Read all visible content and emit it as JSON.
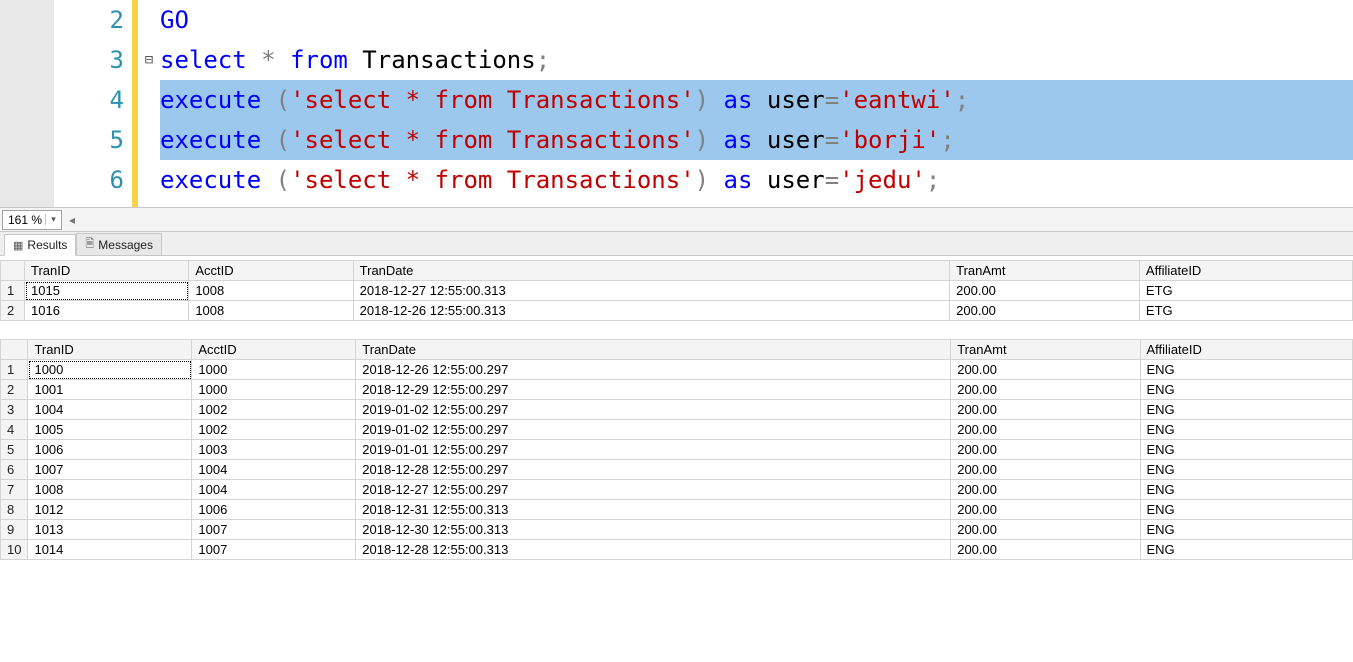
{
  "zoom": {
    "value": "161 %"
  },
  "tabs": {
    "results": "Results",
    "messages": "Messages"
  },
  "code": {
    "lines": [
      {
        "n": 2,
        "fold": "",
        "sel": false,
        "tokens": [
          [
            "kw",
            "GO"
          ]
        ]
      },
      {
        "n": 3,
        "fold": "⊟",
        "sel": false,
        "tokens": [
          [
            "kw",
            "select"
          ],
          [
            "op",
            " * "
          ],
          [
            "kw",
            "from"
          ],
          [
            "id",
            " Transactions"
          ],
          [
            "punc",
            ";"
          ]
        ]
      },
      {
        "n": 4,
        "fold": "",
        "sel": true,
        "tokens": [
          [
            "kw",
            "execute"
          ],
          [
            "punc",
            " ("
          ],
          [
            "str",
            "'select * from Transactions'"
          ],
          [
            "punc",
            ") "
          ],
          [
            "kw",
            "as"
          ],
          [
            "id",
            " user"
          ],
          [
            "op",
            "="
          ],
          [
            "str",
            "'eantwi'"
          ],
          [
            "punc",
            ";"
          ]
        ]
      },
      {
        "n": 5,
        "fold": "",
        "sel": true,
        "tokens": [
          [
            "kw",
            "execute"
          ],
          [
            "punc",
            " ("
          ],
          [
            "str",
            "'select * from Transactions'"
          ],
          [
            "punc",
            ") "
          ],
          [
            "kw",
            "as"
          ],
          [
            "id",
            " user"
          ],
          [
            "op",
            "="
          ],
          [
            "str",
            "'borji'"
          ],
          [
            "punc",
            ";"
          ]
        ]
      },
      {
        "n": 6,
        "fold": "",
        "sel": false,
        "tokens": [
          [
            "kw",
            "execute"
          ],
          [
            "punc",
            " ("
          ],
          [
            "str",
            "'select * from Transactions'"
          ],
          [
            "punc",
            ") "
          ],
          [
            "kw",
            "as"
          ],
          [
            "id",
            " user"
          ],
          [
            "op",
            "="
          ],
          [
            "str",
            "'jedu'"
          ],
          [
            "punc",
            ";"
          ]
        ]
      }
    ]
  },
  "grids": [
    {
      "columns": [
        "TranID",
        "AcctID",
        "TranDate",
        "TranAmt",
        "AffiliateID"
      ],
      "rows": [
        [
          "1015",
          "1008",
          "2018-12-27 12:55:00.313",
          "200.00",
          "ETG"
        ],
        [
          "1016",
          "1008",
          "2018-12-26 12:55:00.313",
          "200.00",
          "ETG"
        ]
      ]
    },
    {
      "columns": [
        "TranID",
        "AcctID",
        "TranDate",
        "TranAmt",
        "AffiliateID"
      ],
      "rows": [
        [
          "1000",
          "1000",
          "2018-12-26 12:55:00.297",
          "200.00",
          "ENG"
        ],
        [
          "1001",
          "1000",
          "2018-12-29 12:55:00.297",
          "200.00",
          "ENG"
        ],
        [
          "1004",
          "1002",
          "2019-01-02 12:55:00.297",
          "200.00",
          "ENG"
        ],
        [
          "1005",
          "1002",
          "2019-01-02 12:55:00.297",
          "200.00",
          "ENG"
        ],
        [
          "1006",
          "1003",
          "2019-01-01 12:55:00.297",
          "200.00",
          "ENG"
        ],
        [
          "1007",
          "1004",
          "2018-12-28 12:55:00.297",
          "200.00",
          "ENG"
        ],
        [
          "1008",
          "1004",
          "2018-12-27 12:55:00.297",
          "200.00",
          "ENG"
        ],
        [
          "1012",
          "1006",
          "2018-12-31 12:55:00.313",
          "200.00",
          "ENG"
        ],
        [
          "1013",
          "1007",
          "2018-12-30 12:55:00.313",
          "200.00",
          "ENG"
        ],
        [
          "1014",
          "1007",
          "2018-12-28 12:55:00.313",
          "200.00",
          "ENG"
        ]
      ]
    }
  ]
}
